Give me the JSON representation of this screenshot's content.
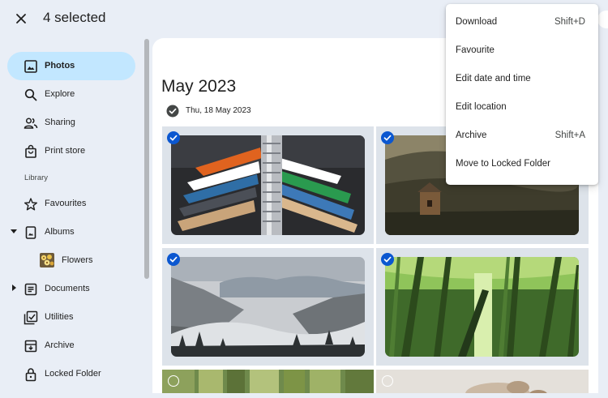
{
  "header": {
    "selected_text": "4 selected"
  },
  "sidebar": {
    "items": [
      {
        "label": "Photos"
      },
      {
        "label": "Explore"
      },
      {
        "label": "Sharing"
      },
      {
        "label": "Print store"
      },
      {
        "label": "Favourites"
      },
      {
        "label": "Albums"
      },
      {
        "label": "Flowers"
      },
      {
        "label": "Documents"
      },
      {
        "label": "Utilities"
      },
      {
        "label": "Archive"
      },
      {
        "label": "Locked Folder"
      }
    ],
    "section_label": "Library"
  },
  "main": {
    "month": "May 2023",
    "date_label": "Thu, 18 May 2023"
  },
  "menu": {
    "items": [
      {
        "label": "Download",
        "shortcut": "Shift+D"
      },
      {
        "label": "Favourite"
      },
      {
        "label": "Edit date and time"
      },
      {
        "label": "Edit location"
      },
      {
        "label": "Archive",
        "shortcut": "Shift+A"
      },
      {
        "label": "Move to Locked Folder"
      }
    ]
  },
  "colors": {
    "accent": "#0b57d0",
    "active_nav": "#c2e7ff",
    "background": "#e9eef6",
    "selected_tile": "#dde3ea"
  }
}
